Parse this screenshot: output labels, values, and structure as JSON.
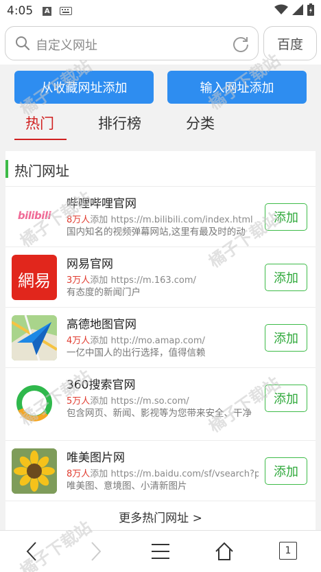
{
  "status_bar": {
    "time": "4:05",
    "icons": [
      "a-notification-icon",
      "keyboard-icon",
      "wifi-icon",
      "signal-icon",
      "battery-charging-icon"
    ]
  },
  "search": {
    "placeholder": "自定义网址",
    "engine_label": "百度"
  },
  "actions": {
    "add_from_favorites": "从收藏网址添加",
    "add_by_input": "输入网址添加"
  },
  "tabs": [
    {
      "label": "热门",
      "active": true
    },
    {
      "label": "排行榜",
      "active": false
    },
    {
      "label": "分类",
      "active": false
    }
  ],
  "section": {
    "title": "热门网址",
    "accent_color": "#3dbb48"
  },
  "sites": [
    {
      "name": "哔哩哔哩官网",
      "count": "8万人",
      "added_label": "添加",
      "url": "https://m.bilibili.com/index.html",
      "description": "国内知名的视频弹幕网站,这里有最及时的动",
      "logo_text": "bilibili",
      "logo_icon": "bilibili-logo-icon",
      "button": "添加"
    },
    {
      "name": "网易官网",
      "count": "3万人",
      "added_label": "添加",
      "url": "https://m.163.com/",
      "description": "有态度的新闻门户",
      "logo_text": "網易",
      "logo_icon": "netease-logo-icon",
      "button": "添加"
    },
    {
      "name": "高德地图官网",
      "count": "4万人",
      "added_label": "添加",
      "url": "http://mo.amap.com/",
      "description": "一亿中国人的出行选择，值得信赖",
      "logo_icon": "amap-logo-icon",
      "button": "添加"
    },
    {
      "name": "360搜索官网",
      "count": "5万人",
      "added_label": "添加",
      "url": "https://m.so.com/",
      "description": "包含网页、新闻、影视等为您带来安全、干净",
      "logo_icon": "so360-logo-icon",
      "button": "添加"
    },
    {
      "name": "唯美图片网",
      "count": "8万人",
      "added_label": "添加",
      "url": "https://m.baidu.com/sf/vsearch?pd=",
      "description": "唯美图、意境图、小清新图片",
      "logo_icon": "sunflower-logo-icon",
      "button": "添加"
    }
  ],
  "more_link": "更多热门网址 >",
  "bottom_nav": {
    "tab_count": "1",
    "icons": [
      "back-icon",
      "forward-icon",
      "menu-icon",
      "home-icon",
      "tabs-icon"
    ]
  },
  "watermark": "橘子下载站",
  "colors": {
    "primary_blue": "#2e8df0",
    "accent_red": "#d02020",
    "accent_green": "#3dbb48"
  }
}
